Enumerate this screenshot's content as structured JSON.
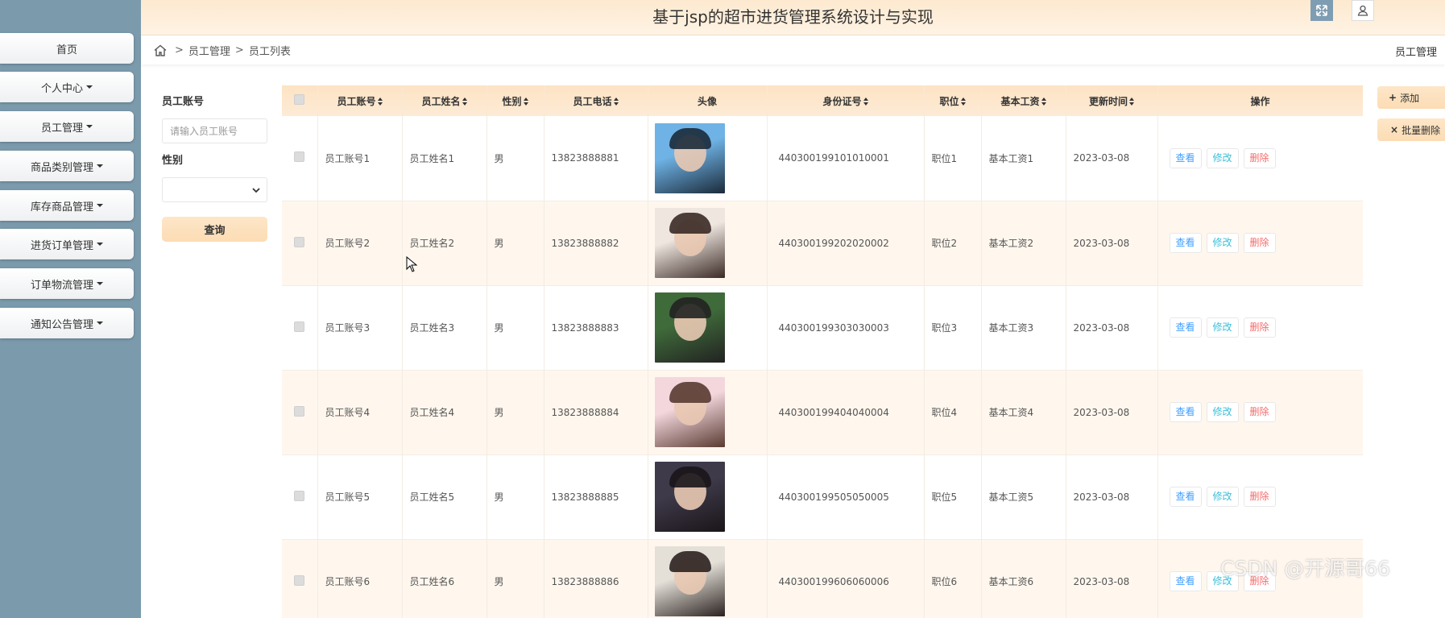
{
  "header": {
    "title": "基于jsp的超市进货管理系统设计与实现"
  },
  "sidebar": {
    "items": [
      {
        "label": "首页",
        "has_caret": false
      },
      {
        "label": "个人中心",
        "has_caret": true
      },
      {
        "label": "员工管理",
        "has_caret": true
      },
      {
        "label": "商品类别管理",
        "has_caret": true
      },
      {
        "label": "库存商品管理",
        "has_caret": true
      },
      {
        "label": "进货订单管理",
        "has_caret": true
      },
      {
        "label": "订单物流管理",
        "has_caret": true
      },
      {
        "label": "通知公告管理",
        "has_caret": true
      }
    ]
  },
  "breadcrumb": {
    "level1": "员工管理",
    "level2": "员工列表",
    "right": "员工管理",
    "separator": ">"
  },
  "search": {
    "account_label": "员工账号",
    "account_placeholder": "请输入员工账号",
    "gender_label": "性别",
    "gender_value": "",
    "button": "查询"
  },
  "actions": {
    "add": "添加",
    "batch_delete": "批量删除"
  },
  "table": {
    "columns": [
      "员工账号",
      "员工姓名",
      "性别",
      "员工电话",
      "头像",
      "身份证号",
      "职位",
      "基本工资",
      "更新时间",
      "操作"
    ],
    "row_buttons": {
      "view": "查看",
      "edit": "修改",
      "delete": "删除"
    },
    "rows": [
      {
        "account": "员工账号1",
        "name": "员工姓名1",
        "gender": "男",
        "phone": "13823888881",
        "id_card": "440300199101010001",
        "position": "职位1",
        "salary": "基本工资1",
        "updated": "2023-03-08"
      },
      {
        "account": "员工账号2",
        "name": "员工姓名2",
        "gender": "男",
        "phone": "13823888882",
        "id_card": "440300199202020002",
        "position": "职位2",
        "salary": "基本工资2",
        "updated": "2023-03-08"
      },
      {
        "account": "员工账号3",
        "name": "员工姓名3",
        "gender": "男",
        "phone": "13823888883",
        "id_card": "440300199303030003",
        "position": "职位3",
        "salary": "基本工资3",
        "updated": "2023-03-08"
      },
      {
        "account": "员工账号4",
        "name": "员工姓名4",
        "gender": "男",
        "phone": "13823888884",
        "id_card": "440300199404040004",
        "position": "职位4",
        "salary": "基本工资4",
        "updated": "2023-03-08"
      },
      {
        "account": "员工账号5",
        "name": "员工姓名5",
        "gender": "男",
        "phone": "13823888885",
        "id_card": "440300199505050005",
        "position": "职位5",
        "salary": "基本工资5",
        "updated": "2023-03-08"
      },
      {
        "account": "员工账号6",
        "name": "员工姓名6",
        "gender": "男",
        "phone": "13823888886",
        "id_card": "440300199606060006",
        "position": "职位6",
        "salary": "基本工资6",
        "updated": "2023-03-08"
      }
    ]
  },
  "watermark": "CSDN @开源哥66",
  "colors": {
    "sidebar_bg": "#7b9bad",
    "header_bg": "#fde9cf",
    "accent": "#fcdcb4",
    "view": "#409eff",
    "edit": "#3bbfd9",
    "delete": "#f56c6c"
  },
  "icons": {
    "expand": "fullscreen-icon",
    "user": "user-icon",
    "home": "home-icon"
  }
}
